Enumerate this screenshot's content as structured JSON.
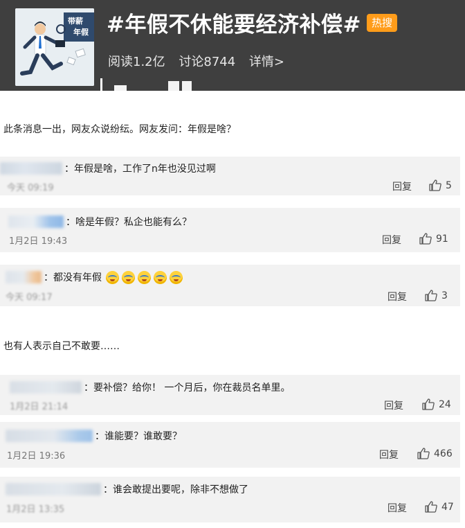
{
  "topic": {
    "title": "#年假不休能要经济补偿#",
    "badge": "热搜",
    "stats": {
      "reads": "阅读1.2亿",
      "discussions": "讨论8744",
      "details": "详情>"
    },
    "image_text": [
      "带薪",
      "年假"
    ]
  },
  "intro1": "此条消息一出，网友众说纷纭。网友发问：年假是啥？",
  "intro2": "也有人表示自己不敢要……",
  "reply_label": "回复",
  "comments": [
    {
      "text": "：年假是啥，工作了n年也没见过啊",
      "time": "今天 09:19",
      "likes": "5"
    },
    {
      "text": "：啥是年假？私企也能有么？",
      "time": "1月2日 19:43",
      "likes": "91"
    },
    {
      "text": "：都没有年假",
      "time": "今天 09:17",
      "likes": "3"
    },
    {
      "text": "：要补偿？给你！ 一个月后，你在裁员名单里。",
      "time": "1月2日 21:14",
      "likes": "24"
    },
    {
      "text": "：谁能要？谁敢要？",
      "time": "1月2日 19:36",
      "likes": "466"
    },
    {
      "text": "：谁会敢提出要呢，除非不想做了",
      "time": "1月2日 13:35",
      "likes": "47"
    }
  ],
  "colors": {
    "banner": "#3f3f3f",
    "badge": "#ff9c1a",
    "card": "#f2f2f2"
  },
  "icons": [
    "thumbs-up-icon",
    "emoji-sweat-icon"
  ]
}
